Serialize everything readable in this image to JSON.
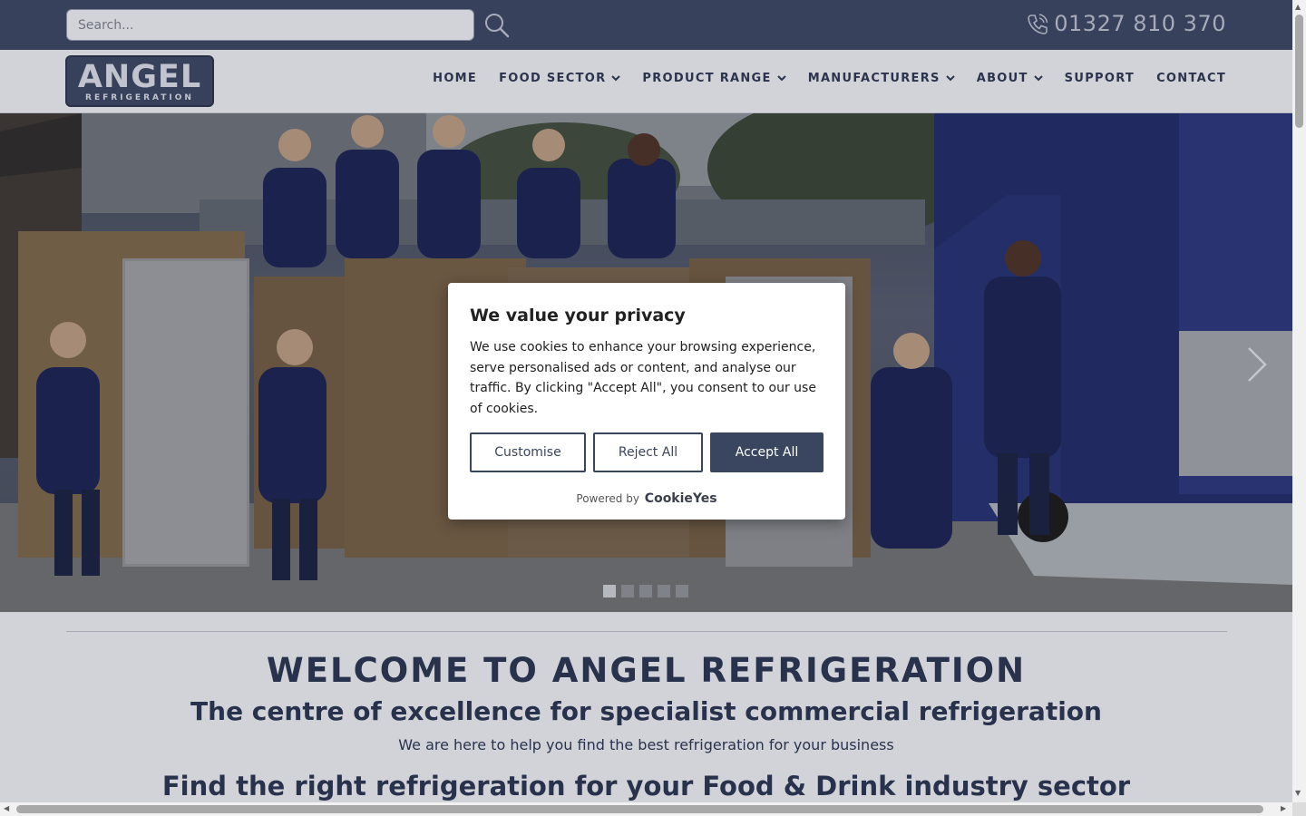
{
  "header": {
    "search_placeholder": "Search...",
    "search_icon": "search-icon",
    "phone_icon": "phone-icon",
    "phone": "01327 810 370"
  },
  "logo": {
    "main": "ANGEL",
    "sub": "REFRIGERATION"
  },
  "nav": {
    "items": [
      {
        "label": "HOME",
        "dropdown": false
      },
      {
        "label": "FOOD SECTOR",
        "dropdown": true
      },
      {
        "label": "PRODUCT RANGE",
        "dropdown": true
      },
      {
        "label": "MANUFACTURERS",
        "dropdown": true
      },
      {
        "label": "ABOUT",
        "dropdown": true
      },
      {
        "label": "SUPPORT",
        "dropdown": false
      },
      {
        "label": "CONTACT",
        "dropdown": false
      }
    ]
  },
  "hero": {
    "next_icon": "chevron-right-icon",
    "slides": 5,
    "active_slide": 1
  },
  "welcome": {
    "title": "WELCOME TO ANGEL REFRIGERATION",
    "subtitle": "The centre of excellence for specialist commercial refrigeration",
    "text": "We are here to help you find the best refrigeration for your business",
    "sector_heading": "Find the right refrigeration for your Food & Drink industry sector"
  },
  "cookie": {
    "title": "We value your privacy",
    "body": "We use cookies to enhance your browsing experience, serve personalised ads or content, and analyse our traffic. By clicking \"Accept All\", you consent to our use of cookies.",
    "customise": "Customise",
    "reject": "Reject All",
    "accept": "Accept All",
    "powered_by": "Powered by",
    "brand": "CookieYes"
  },
  "colors": {
    "brand_navy": "#3a4560",
    "text_navy": "#2a3450",
    "page_bg": "#e9ebee"
  }
}
